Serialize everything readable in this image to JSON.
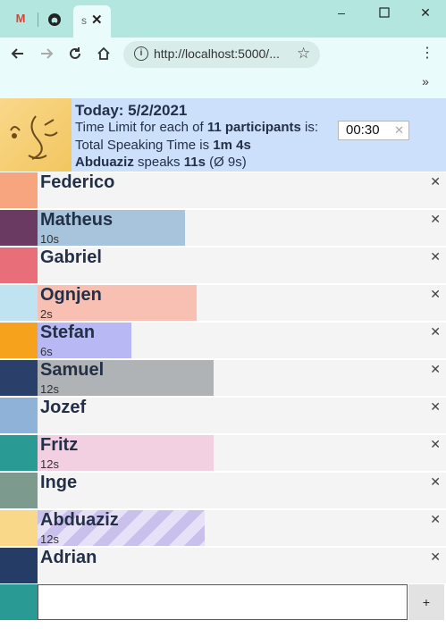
{
  "browser": {
    "tab_title": "s",
    "url": "http://localhost:5000/..."
  },
  "header": {
    "title": "Today: 5/2/2021",
    "time_limit_prefix": "Time Limit for each of ",
    "participant_count_label": "11 participants",
    "time_limit_suffix": " is:",
    "time_limit_value": "00:30",
    "total_prefix": "Total Speaking Time is ",
    "total_value": "1m 4s",
    "current_speaker": "Abduaziz",
    "speaks_label": " speaks ",
    "speaker_time": "11s",
    "average_label": " (Ø 9s)"
  },
  "participants": [
    {
      "name": "Federico",
      "time": "",
      "bar_fraction": 0,
      "bar_color": "#f4f4f4",
      "avatar_color": "#f6a57e",
      "active": false
    },
    {
      "name": "Matheus",
      "time": "10s",
      "bar_fraction": 0.36,
      "bar_color": "#a7c4dc",
      "avatar_color": "#6b3a63",
      "active": false
    },
    {
      "name": "Gabriel",
      "time": "",
      "bar_fraction": 0,
      "bar_color": "#f4f4f4",
      "avatar_color": "#e86e7a",
      "active": false
    },
    {
      "name": "Ognjen",
      "time": "2s",
      "bar_fraction": 0.39,
      "bar_color": "#f8c0b3",
      "avatar_color": "#bfe3f0",
      "active": false
    },
    {
      "name": "Stefan",
      "time": "6s",
      "bar_fraction": 0.23,
      "bar_color": "#b7b8f4",
      "avatar_color": "#f6a21d",
      "active": false
    },
    {
      "name": "Samuel",
      "time": "12s",
      "bar_fraction": 0.43,
      "bar_color": "#b0b3b6",
      "avatar_color": "#2a3f6a",
      "active": false
    },
    {
      "name": "Jozef",
      "time": "",
      "bar_fraction": 0,
      "bar_color": "#f4f4f4",
      "avatar_color": "#8fb2d8",
      "active": false
    },
    {
      "name": "Fritz",
      "time": "12s",
      "bar_fraction": 0.43,
      "bar_color": "#f2d0e2",
      "avatar_color": "#2a9a94",
      "active": false
    },
    {
      "name": "Inge",
      "time": "",
      "bar_fraction": 0,
      "bar_color": "#f4f4f4",
      "avatar_color": "#7d9a8e",
      "active": false
    },
    {
      "name": "Abduaziz",
      "time": "12s",
      "bar_fraction": 0.41,
      "bar_color": "#c9c0ec",
      "avatar_color": "#f9d88a",
      "active": true
    },
    {
      "name": "Adrian",
      "time": "",
      "bar_fraction": 0,
      "bar_color": "#f4f4f4",
      "avatar_color": "#243c66",
      "active": false
    }
  ],
  "add_participant": {
    "button_label": "+",
    "avatar_color": "#2a9a94"
  }
}
